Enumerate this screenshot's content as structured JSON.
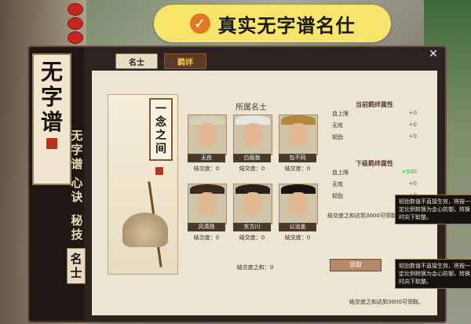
{
  "banner": {
    "text": "真实无字谱名仕",
    "check_icon": "check-icon"
  },
  "top_tabs": {
    "active": "名士",
    "inactive": "羁绊"
  },
  "side": {
    "title": "无字谱",
    "tabs": [
      {
        "label": "无字谱"
      },
      {
        "label": "心诀"
      },
      {
        "label": "秘技"
      },
      {
        "label": "名士"
      }
    ]
  },
  "scroll": {
    "title": "一念之间"
  },
  "famous": {
    "header": "所属名士",
    "people": [
      {
        "name": "无良",
        "bond": "结交度：0"
      },
      {
        "name": "白眉翁",
        "bond": "结交度：0"
      },
      {
        "name": "包不同",
        "bond": "结交度：0"
      },
      {
        "name": "风清扬",
        "bond": "结交度：0"
      },
      {
        "name": "东方川",
        "bond": "结交度：0"
      },
      {
        "name": "公治盖",
        "bond": "结交度：0"
      }
    ],
    "sum": "结交度之和：0"
  },
  "attrs": {
    "current_header": "当前羁绊属性",
    "current": [
      {
        "label": "血上限",
        "value": "+0"
      },
      {
        "label": "无攻",
        "value": "+0"
      },
      {
        "label": "韧劲",
        "value": "+0"
      }
    ],
    "next_header": "下级羁绊属性",
    "next": [
      {
        "label": "血上限",
        "value": "+500"
      },
      {
        "label": "无攻",
        "value": "+0"
      },
      {
        "label": "韧劲",
        "value": "+0"
      }
    ],
    "note": "结交度之和达到3000可领取。"
  },
  "tips": [
    {
      "prefix": "韧劲数值不直接生效，将按一定比例转换为会心防御，转换时向下取整。"
    },
    {
      "prefix": "韧劲数值不直接生效，将按一定比例转换为会心防御，转换时向下取整。"
    }
  ],
  "bottom": {
    "button": "领取",
    "note": "结交度之和达到3000可领取。"
  },
  "colors": {
    "banner": "#f6e56a",
    "check": "#e07a22",
    "seal": "#b8321e",
    "tab_inactive_text": "#f2c058"
  }
}
